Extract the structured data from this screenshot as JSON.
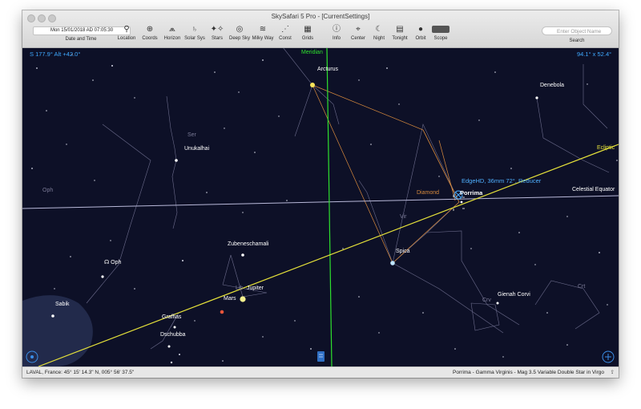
{
  "window": {
    "title": "SkySafari 5 Pro - [CurrentSettings]"
  },
  "toolbar": {
    "date_value": "Mon 15/01/2018 AD 07:05:30",
    "date_label": "Date and Time",
    "items": [
      {
        "label": "Location",
        "icon": "location-pin-icon"
      },
      {
        "label": "Coords",
        "icon": "coords-icon"
      },
      {
        "label": "Horizon",
        "icon": "horizon-icon"
      },
      {
        "label": "Solar Sys",
        "icon": "saturn-icon"
      },
      {
        "label": "Stars",
        "icon": "stars-icon"
      },
      {
        "label": "Deep Sky",
        "icon": "galaxy-icon"
      },
      {
        "label": "Milky Way",
        "icon": "milky-way-icon"
      },
      {
        "label": "Const",
        "icon": "constellation-icon"
      },
      {
        "label": "Grids",
        "icon": "grid-icon"
      },
      {
        "label": "Info",
        "icon": "info-icon"
      },
      {
        "label": "Center",
        "icon": "center-icon"
      },
      {
        "label": "Night",
        "icon": "night-icon"
      },
      {
        "label": "Tonight",
        "icon": "tonight-icon"
      },
      {
        "label": "Orbit",
        "icon": "orbit-icon"
      },
      {
        "label": "Scope",
        "icon": "scope-icon"
      }
    ],
    "search_placeholder": "Enter Object Name",
    "search_label": "Search"
  },
  "sky": {
    "coords_readout": "S 177.9° Alt +42.0°",
    "fov_readout": "94.1° x 52.4°",
    "meridian_label": "Meridian",
    "ecliptic_label": "Ecliptic",
    "equator_label": "Celestial Equator",
    "scope_label": "EdgeHD, 36mm 72°, Reducer",
    "selected_label": "Porrima",
    "colors": {
      "meridian": "#2ee02e",
      "ecliptic": "#e6e23a",
      "equator": "#b8b8d8",
      "background": "#0d1027",
      "constellation": "#6c6c8c",
      "selection": "#4fb0ff",
      "diamond": "#d88a3c"
    },
    "labels": {
      "arcturus": "Arcturus",
      "denebola": "Denebola",
      "unukalhai": "Unukalhai",
      "ser": "Ser",
      "oph": "Oph",
      "diamond": "Diamond",
      "vir": "Vir",
      "spica": "Spica",
      "zubeneschamali": "Zubeneschamali",
      "oph_symbol": "☊ Oph",
      "lib": "Lib",
      "jupiter": "Jupiter",
      "mars": "Mars",
      "sabik": "Sabik",
      "graffias": "Graffias",
      "dschubba": "Dschubba",
      "crv": "Crv",
      "gienah": "Gienah Corvi",
      "crt": "Crt"
    }
  },
  "status": {
    "location": "LAVAL, France: 45° 15' 14.3\" N, 005° 56' 37.5\"",
    "object": "Porrima - Gamma Virginis - Mag 3.5 Variable Double Star in Virgo"
  }
}
